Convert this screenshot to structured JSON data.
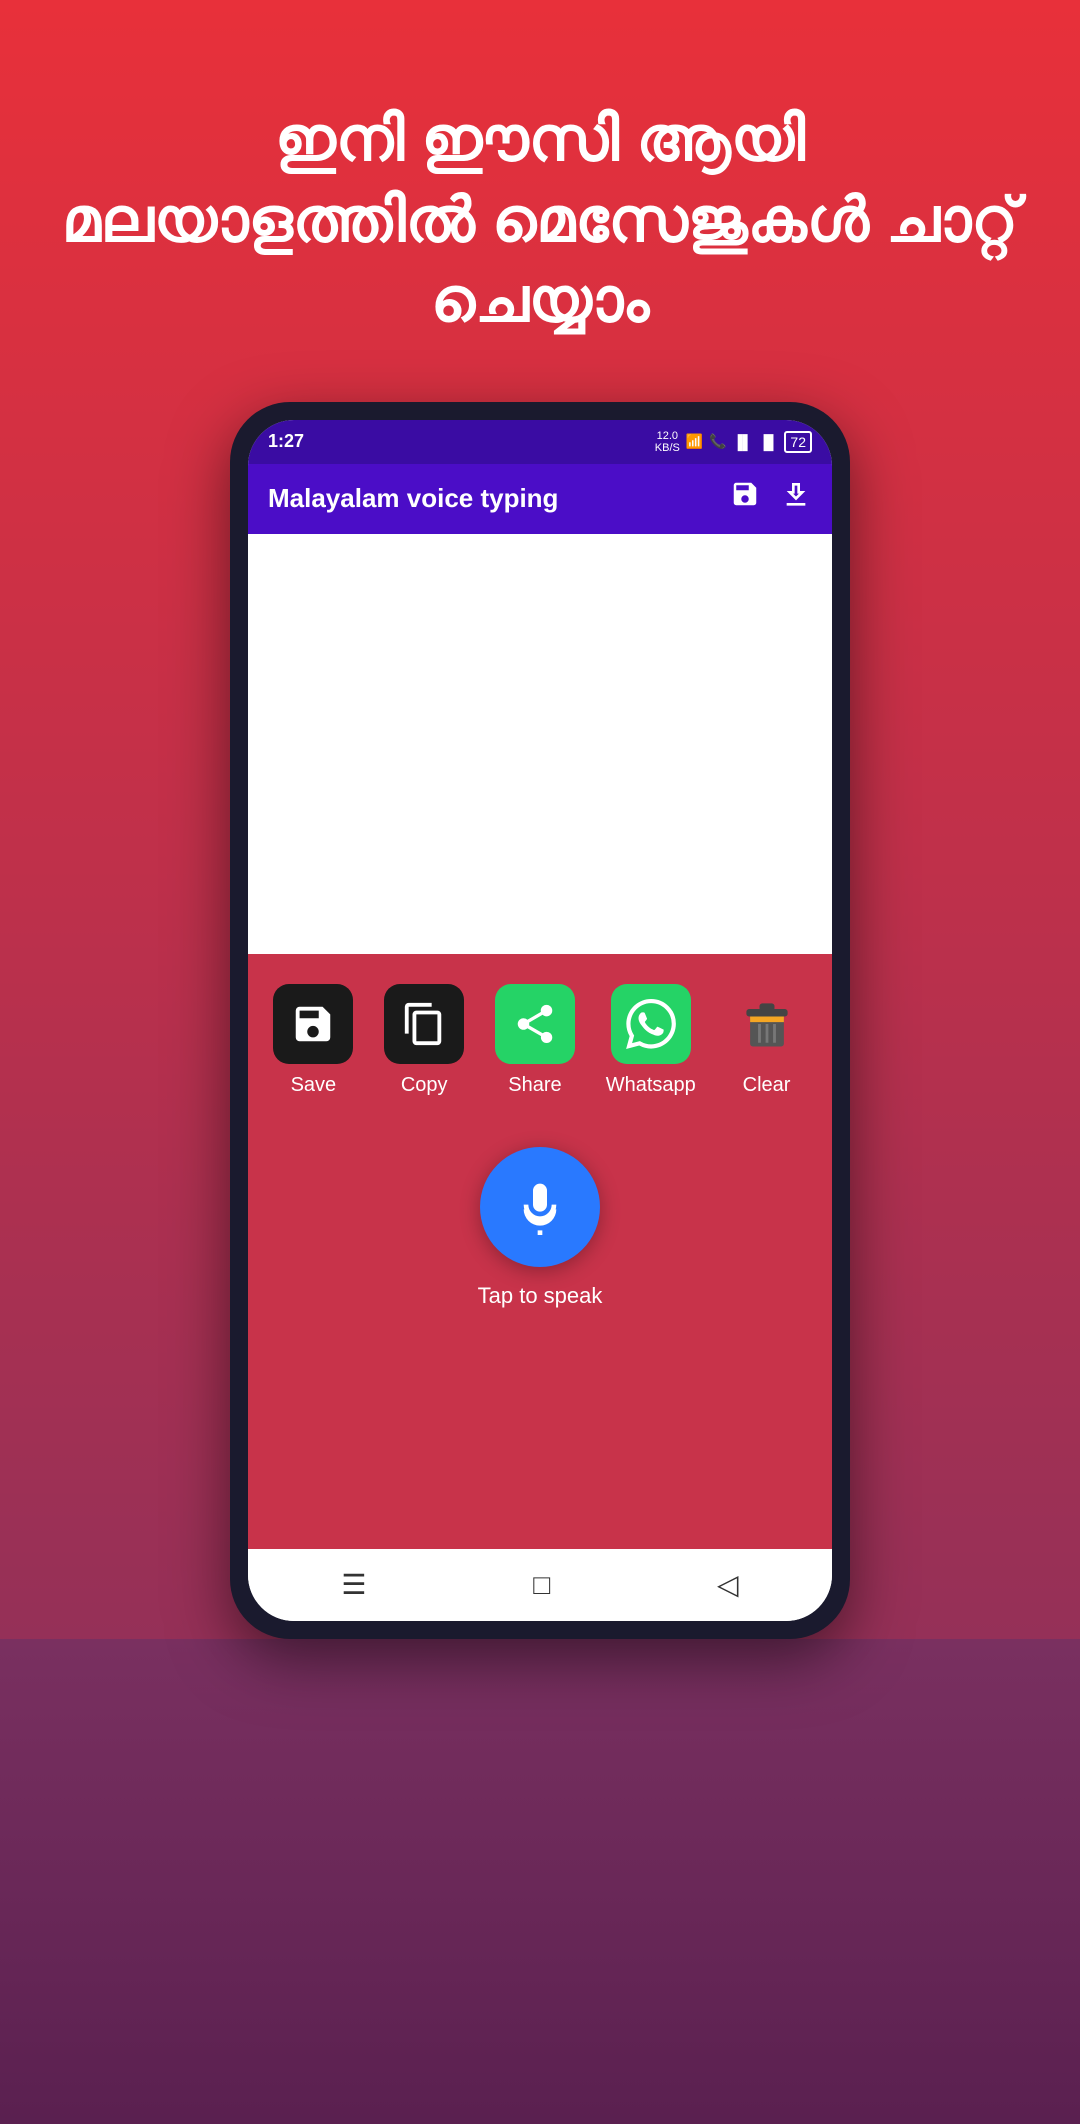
{
  "background": {
    "headline": "ഇനി ഈസി ആയി മലയാളത്തിൽ മെസേജുകൾ ചാറ്റ് ചെയ്യാം"
  },
  "statusBar": {
    "time": "1:27",
    "kbs": "12.0\nKB/S",
    "battery": "72"
  },
  "appBar": {
    "title": "Malayalam voice typing",
    "saveIcon": "💾",
    "downloadIcon": "⬇"
  },
  "actions": [
    {
      "label": "Save",
      "icon": "save",
      "type": "dark"
    },
    {
      "label": "Copy",
      "icon": "copy",
      "type": "dark"
    },
    {
      "label": "Share",
      "icon": "share",
      "type": "green"
    },
    {
      "label": "Whatsapp",
      "icon": "whatsapp",
      "type": "whatsapp"
    },
    {
      "label": "Clear",
      "icon": "clear",
      "type": "dark"
    }
  ],
  "mic": {
    "label": "Tap to speak"
  },
  "bottomNav": {
    "menu": "☰",
    "home": "□",
    "back": "◁"
  }
}
